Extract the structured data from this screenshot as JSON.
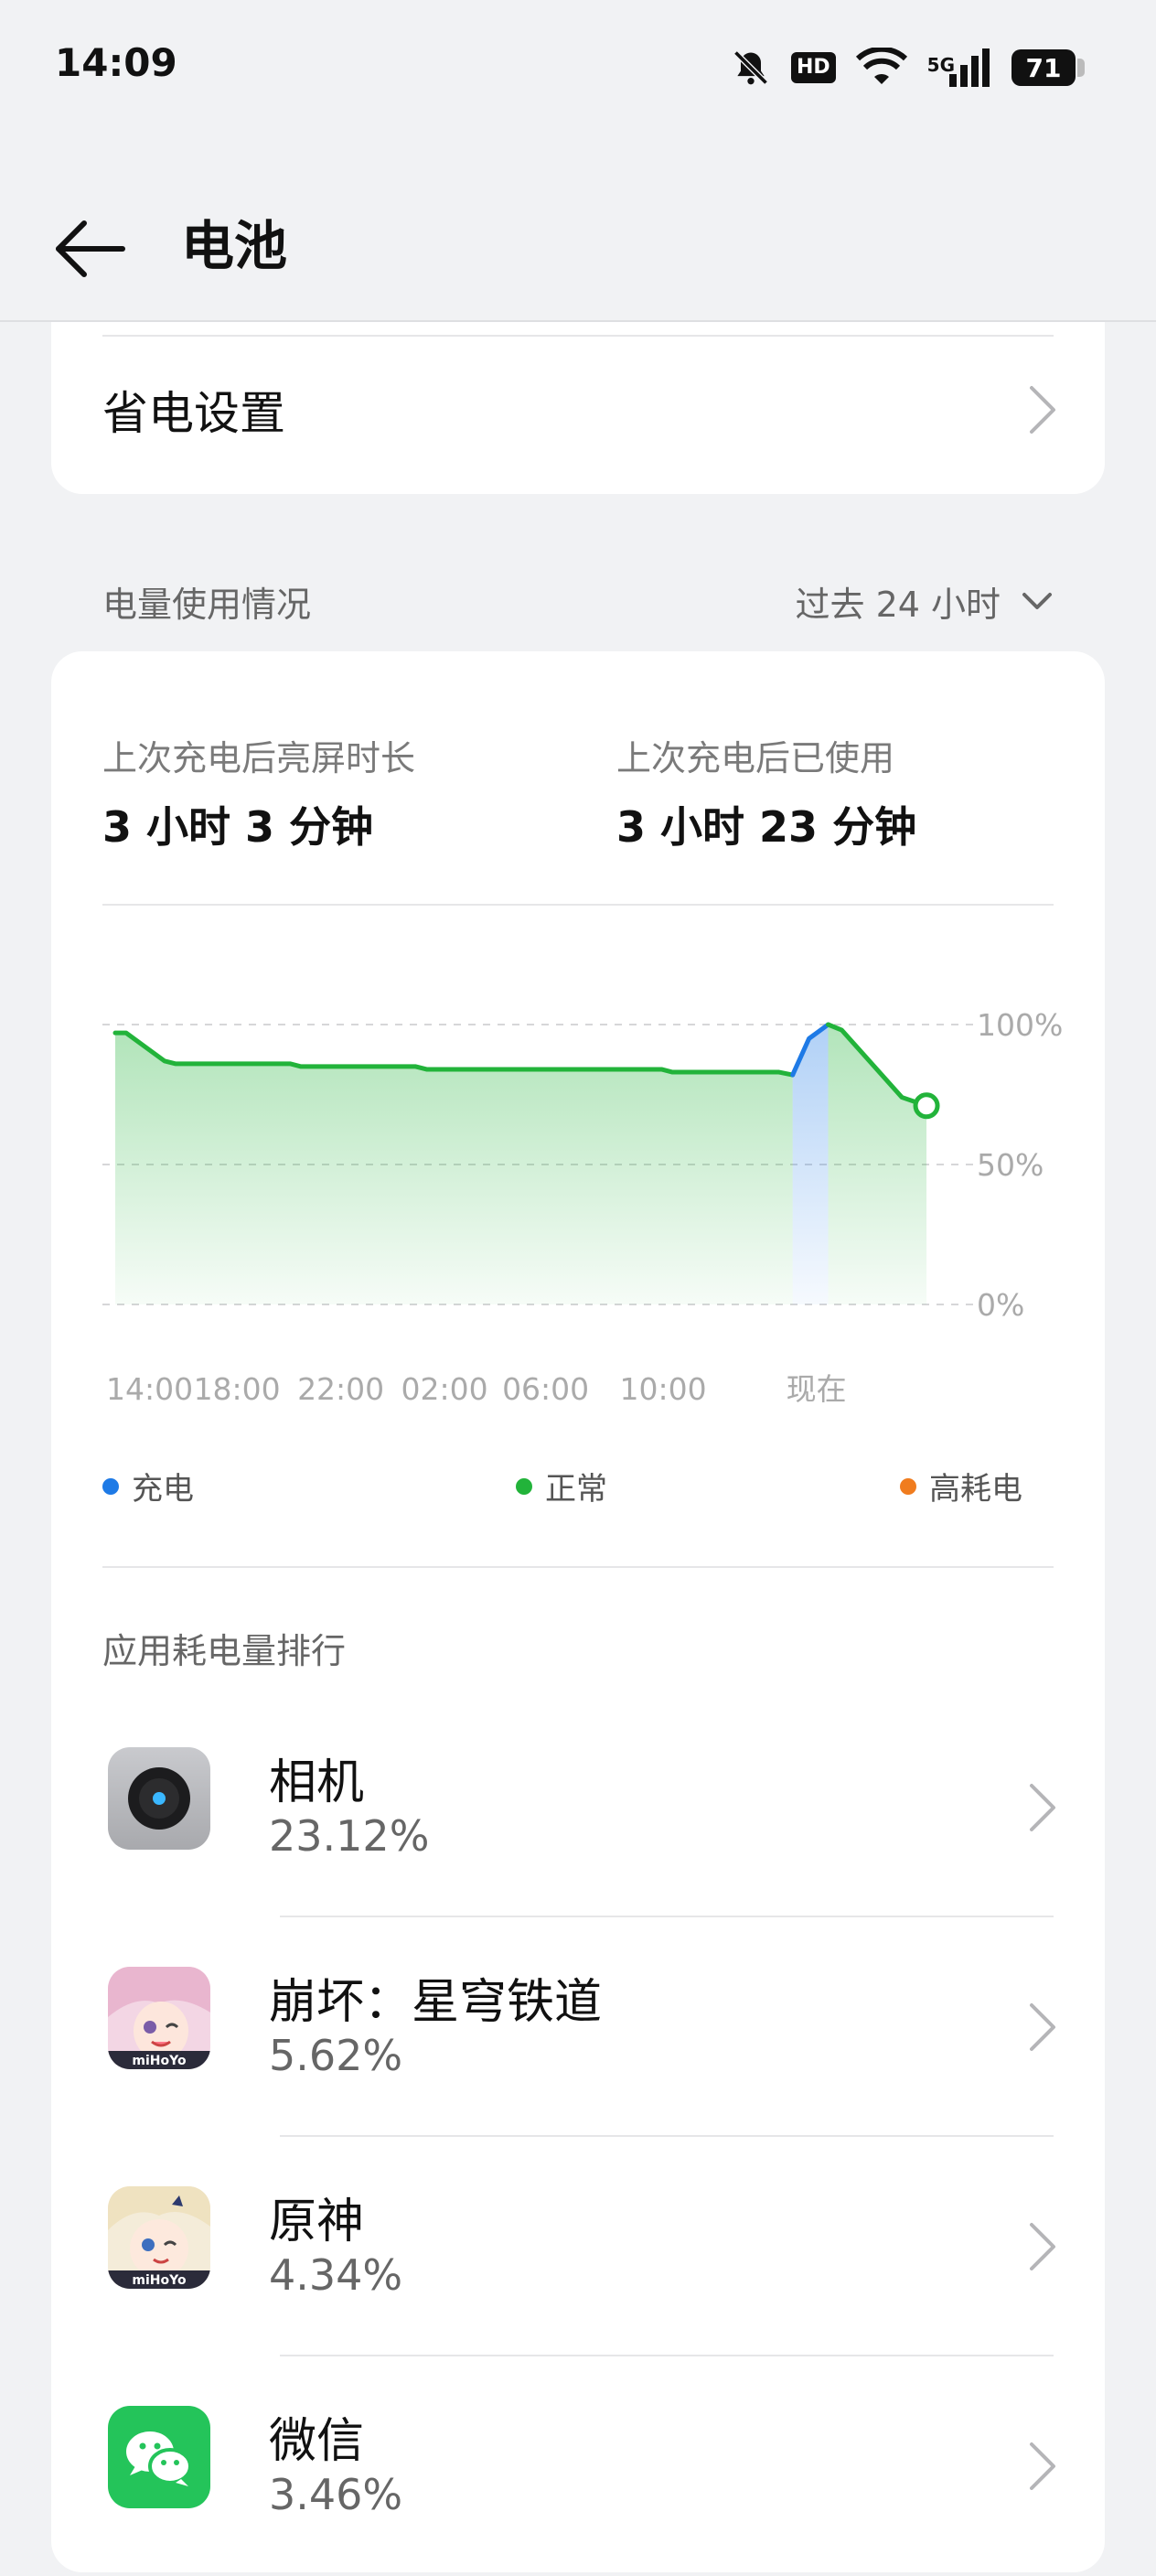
{
  "status_bar": {
    "time": "14:09",
    "hd": "HD",
    "network": "5G",
    "battery_level": "71",
    "icons": [
      "mute-bell-icon",
      "hd-icon",
      "wifi-icon",
      "5g-signal-icon",
      "battery-icon"
    ]
  },
  "header": {
    "back_icon": "back-arrow-icon",
    "title": "电池"
  },
  "power_saving": {
    "label": "省电设置"
  },
  "usage_section": {
    "title": "电量使用情况",
    "range_label": "过去 24 小时",
    "screen_time_label": "上次充电后亮屏时长",
    "screen_time_value": "3 小时 3 分钟",
    "used_label": "上次充电后已使用",
    "used_value": "3 小时 23 分钟"
  },
  "chart_data": {
    "type": "area",
    "x_ticks": [
      "14:00",
      "18:00",
      "22:00",
      "02:00",
      "06:00",
      "10:00",
      "现在"
    ],
    "y_ticks": [
      "100%",
      "50%",
      "0%"
    ],
    "ylim": [
      0,
      100
    ],
    "series": [
      {
        "name": "正常",
        "color": "#22b33a",
        "points": [
          [
            0,
            97
          ],
          [
            0.4,
            97
          ],
          [
            1.8,
            87
          ],
          [
            2.2,
            86
          ],
          [
            6.4,
            86
          ],
          [
            6.8,
            85
          ],
          [
            11.0,
            85
          ],
          [
            11.4,
            84
          ],
          [
            20.0,
            84
          ],
          [
            20.4,
            83
          ],
          [
            24.3,
            83
          ],
          [
            24.8,
            82
          ]
        ]
      },
      {
        "name": "充电",
        "color": "#1e7ae6",
        "points": [
          [
            24.8,
            82
          ],
          [
            25.4,
            95
          ],
          [
            26.1,
            100
          ]
        ]
      },
      {
        "name": "正常",
        "color": "#22b33a",
        "points": [
          [
            26.1,
            100
          ],
          [
            26.6,
            98
          ],
          [
            28.8,
            74
          ],
          [
            29.7,
            71
          ]
        ]
      }
    ],
    "grid": true,
    "legend": [
      {
        "label": "充电",
        "color": "#1e7ae6"
      },
      {
        "label": "正常",
        "color": "#22b33a"
      },
      {
        "label": "高耗电",
        "color": "#f07c1e"
      }
    ]
  },
  "ranking": {
    "title": "应用耗电量排行",
    "apps": [
      {
        "name": "相机",
        "percent": "23.12%",
        "icon": "camera-icon"
      },
      {
        "name": "崩坏：星穹铁道",
        "percent": "5.62%",
        "icon": "honkai-star-rail-icon"
      },
      {
        "name": "原神",
        "percent": "4.34%",
        "icon": "genshin-impact-icon"
      },
      {
        "name": "微信",
        "percent": "3.46%",
        "icon": "wechat-icon"
      }
    ]
  }
}
